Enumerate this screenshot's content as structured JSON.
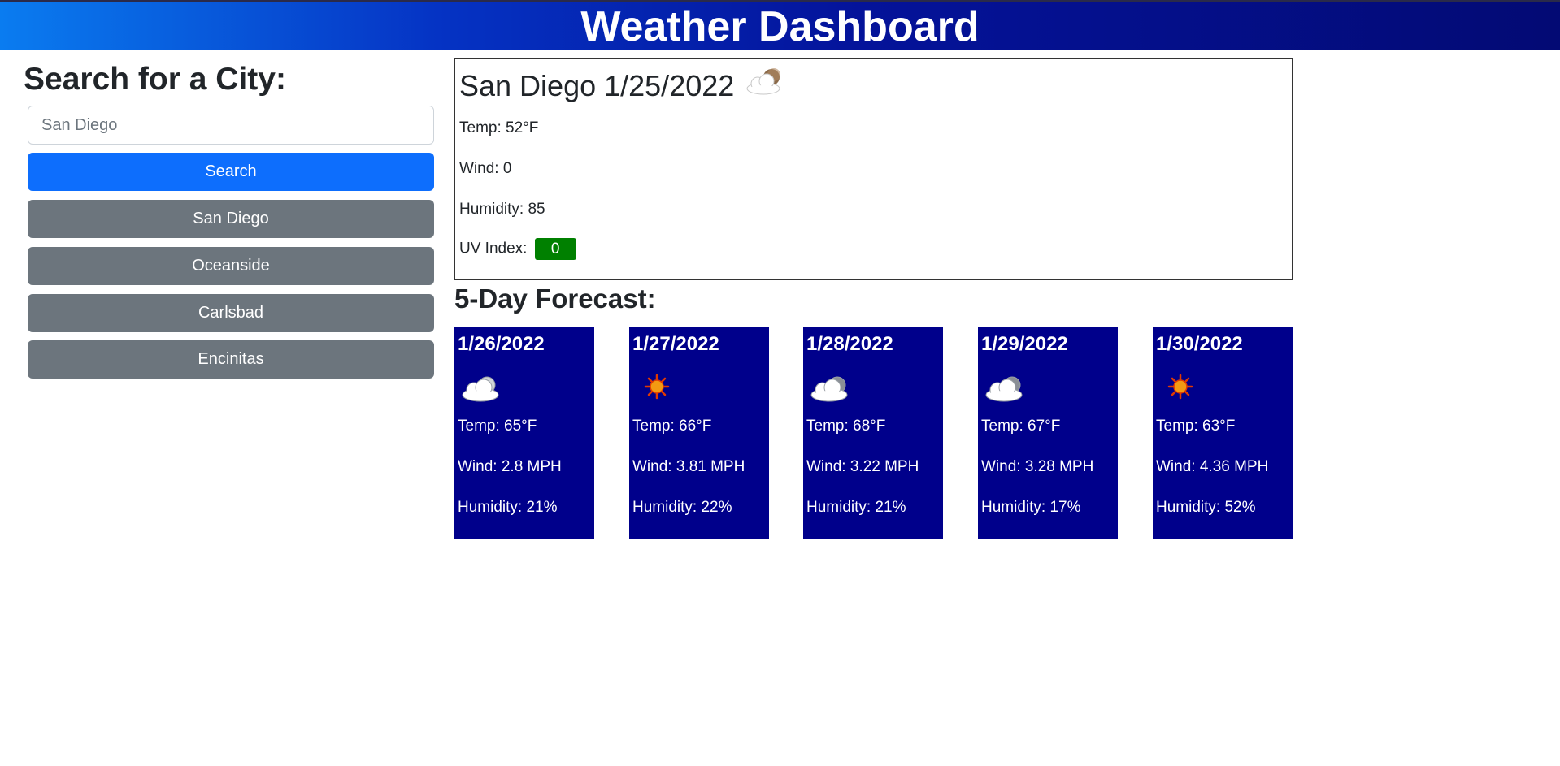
{
  "header": {
    "title": "Weather Dashboard"
  },
  "search": {
    "heading": "Search for a City:",
    "placeholder": "San Diego",
    "value": "",
    "button_label": "Search"
  },
  "history": [
    "San Diego",
    "Oceanside",
    "Carlsbad",
    "Encinitas"
  ],
  "current": {
    "title": "San Diego 1/25/2022",
    "icon": "partly-cloudy-night-icon",
    "temp": "Temp: 52°F",
    "wind": "Wind: 0",
    "humidity": "Humidity: 85",
    "uv_label": "UV Index:",
    "uv_value": "0",
    "uv_color": "#008000"
  },
  "forecast": {
    "heading": "5-Day Forecast:",
    "card_color": "#00008b",
    "days": [
      {
        "date": "1/26/2022",
        "icon": "partly-cloudy-icon",
        "temp": "Temp: 65°F",
        "wind": "Wind: 2.8 MPH",
        "humidity": "Humidity: 21%"
      },
      {
        "date": "1/27/2022",
        "icon": "sun-icon",
        "temp": "Temp: 66°F",
        "wind": "Wind: 3.81 MPH",
        "humidity": "Humidity: 22%"
      },
      {
        "date": "1/28/2022",
        "icon": "partly-cloudy-icon",
        "temp": "Temp: 68°F",
        "wind": "Wind: 3.22 MPH",
        "humidity": "Humidity: 21%"
      },
      {
        "date": "1/29/2022",
        "icon": "partly-cloudy-icon",
        "temp": "Temp: 67°F",
        "wind": "Wind: 3.28 MPH",
        "humidity": "Humidity: 17%"
      },
      {
        "date": "1/30/2022",
        "icon": "sun-icon",
        "temp": "Temp: 63°F",
        "wind": "Wind: 4.36 MPH",
        "humidity": "Humidity: 52%"
      }
    ]
  }
}
